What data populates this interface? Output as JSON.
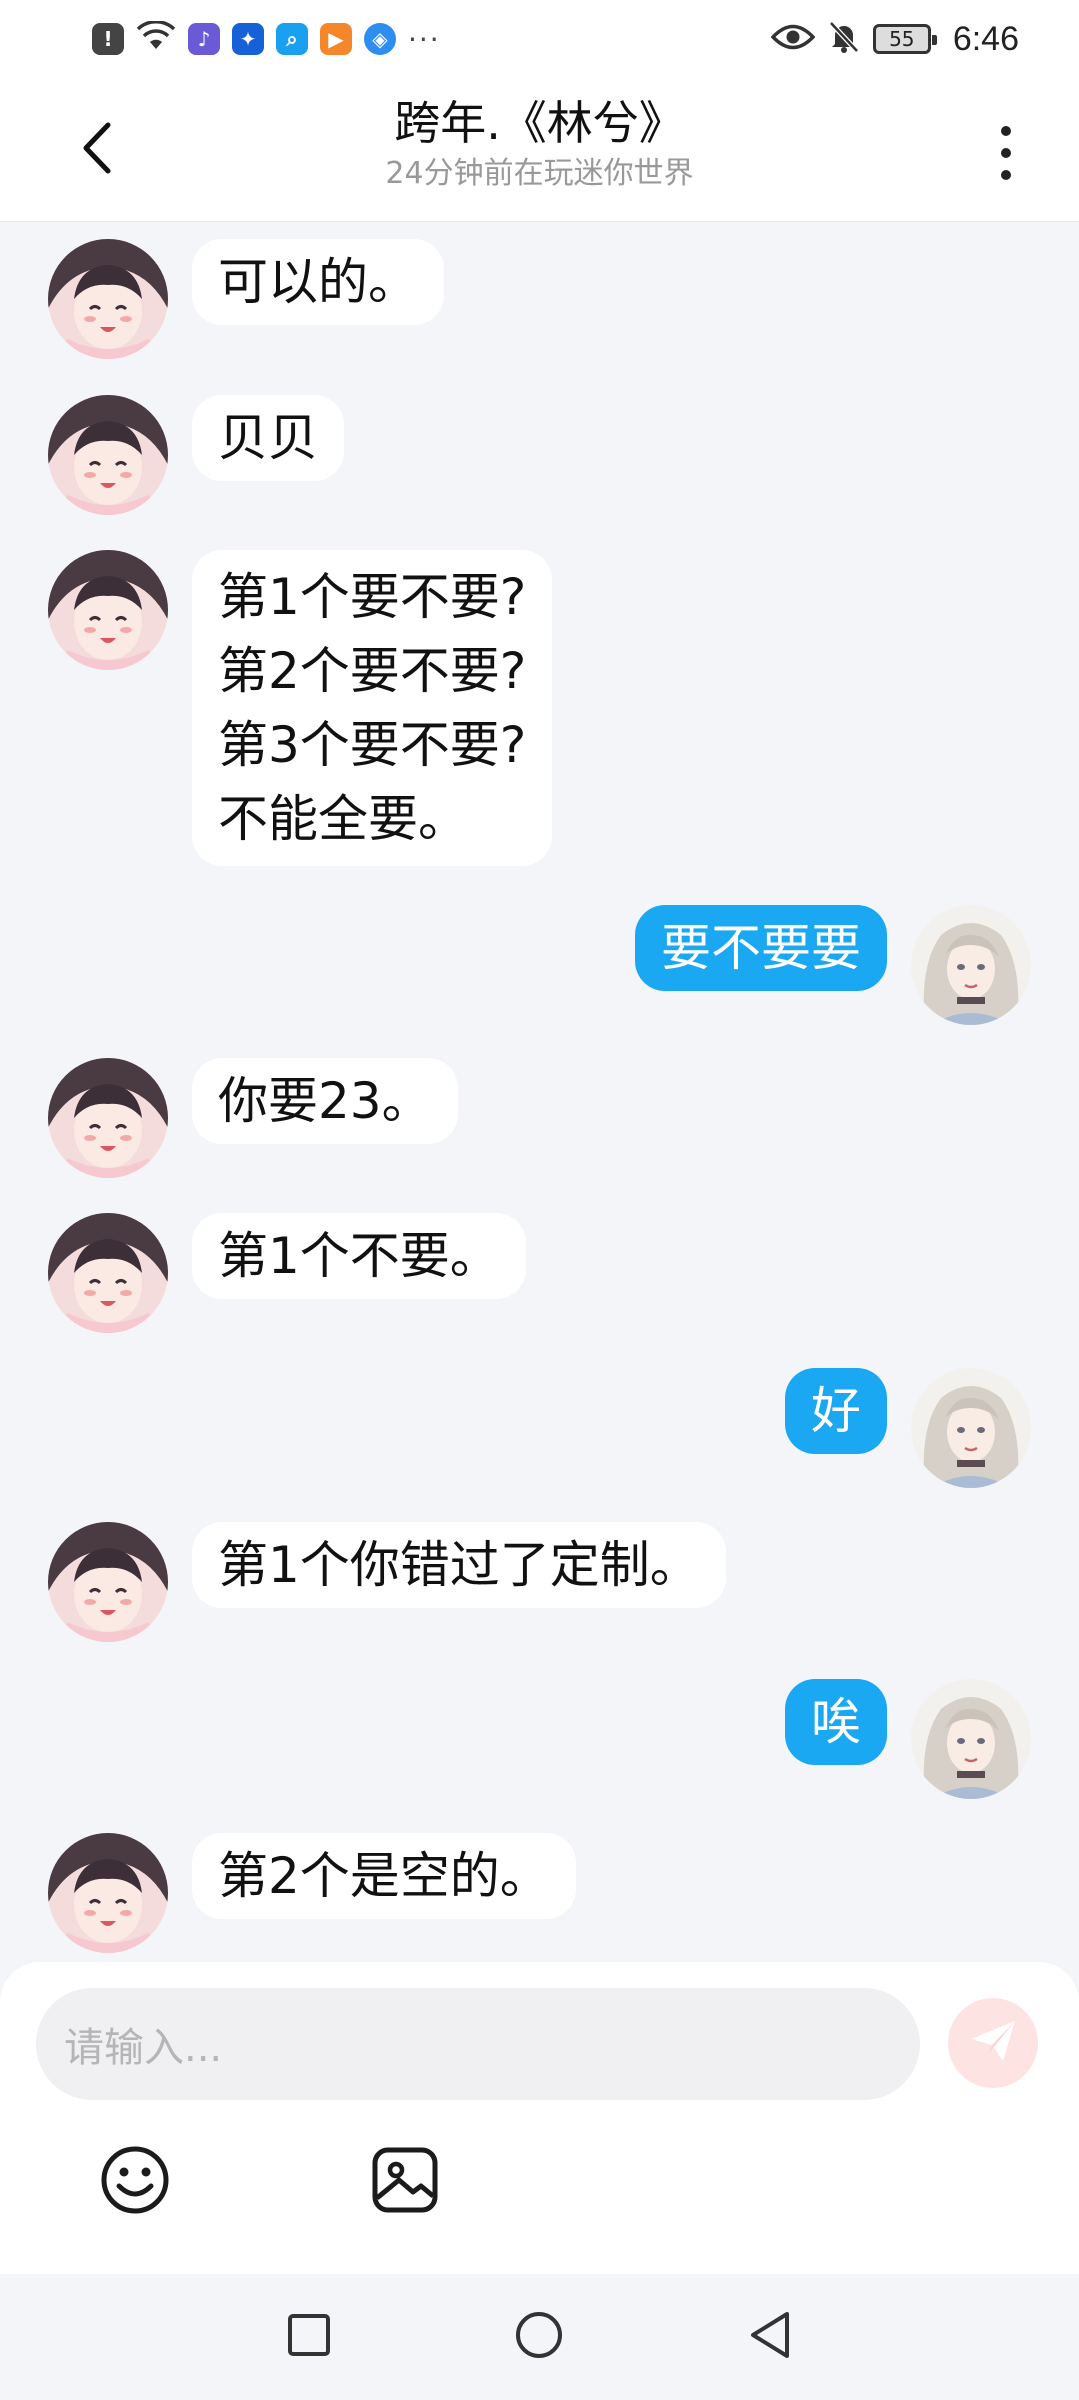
{
  "status_bar": {
    "time": "6:46",
    "battery": "55",
    "more": "···",
    "app_icons": [
      {
        "name": "alert-notification-icon",
        "glyph": "!",
        "color": "#444444"
      },
      {
        "name": "music-app-icon",
        "glyph": "♪",
        "color": "#6b5ad6"
      },
      {
        "name": "bulb-app-icon",
        "glyph": "✦",
        "color": "#1660d8"
      },
      {
        "name": "search-app-icon",
        "glyph": "⌕",
        "color": "#1aa0f0"
      },
      {
        "name": "video-app-icon",
        "glyph": "▶",
        "color": "#f5862a"
      },
      {
        "name": "browser-app-icon",
        "glyph": "◈",
        "color": "#2e8ef0"
      }
    ]
  },
  "header": {
    "title": "跨年.《林兮》",
    "subtitle": "24分钟前在玩迷你世界"
  },
  "messages": [
    {
      "side": "left",
      "text": "可以的。"
    },
    {
      "side": "left",
      "text": "贝贝"
    },
    {
      "side": "left",
      "text": "第1个要不要?\n第2个要不要?\n第3个要不要?\n不能全要。"
    },
    {
      "side": "right",
      "text": "要不要要"
    },
    {
      "side": "left",
      "text": "你要23。"
    },
    {
      "side": "left",
      "text": "第1个不要。"
    },
    {
      "side": "right",
      "text": "好"
    },
    {
      "side": "left",
      "text": "第1个你错过了定制。"
    },
    {
      "side": "right",
      "text": "唉"
    },
    {
      "side": "left",
      "text": "第2个是空的。"
    }
  ],
  "input": {
    "placeholder": "请输入..."
  },
  "colors": {
    "my_bubble": "#1aa8f2",
    "their_bubble": "#ffffff",
    "background": "#f4f5f8",
    "send_button": "#f6a9a3"
  }
}
